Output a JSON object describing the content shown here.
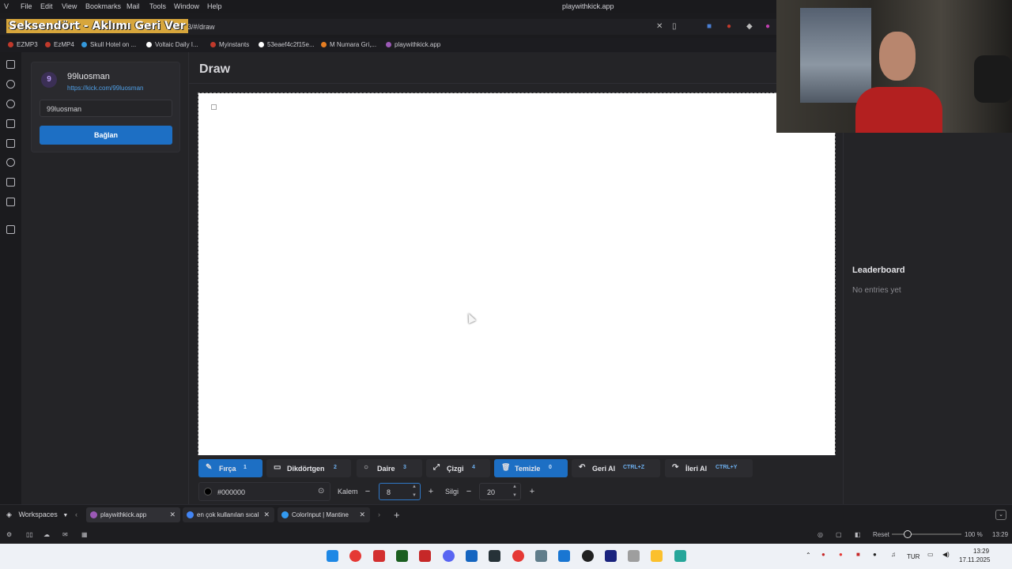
{
  "menubar": {
    "items": [
      "File",
      "Edit",
      "View",
      "Bookmarks",
      "Mail",
      "Tools",
      "Window",
      "Help"
    ],
    "window_title": "playwithkick.app"
  },
  "stream_overlay": {
    "title": "Seksendört - Aklımı Geri Ver"
  },
  "address": {
    "url": "5173/#/draw"
  },
  "bookmarks": [
    {
      "label": "EZMP3",
      "color": "#c0392b"
    },
    {
      "label": "EzMP4",
      "color": "#c0392b"
    },
    {
      "label": "Skull Hotel on ...",
      "color": "#3498db"
    },
    {
      "label": "Voltaic Daily I...",
      "color": "#ffffff"
    },
    {
      "label": "Myinstants",
      "color": "#c0392b"
    },
    {
      "label": "53eaef4c2f15e...",
      "color": "#ffffff"
    },
    {
      "label": "M Numara Gri,...",
      "color": "#e67e22"
    },
    {
      "label": "playwithkick.app",
      "color": "#9b59b6"
    }
  ],
  "user": {
    "avatar_letter": "9",
    "name": "99luosman",
    "link": "https://kick.com/99luosman",
    "input_value": "99luosman",
    "connect_label": "Bağlan"
  },
  "page": {
    "title": "Draw"
  },
  "leaderboard": {
    "title": "Leaderboard",
    "empty": "No entries yet"
  },
  "toolbar": {
    "tools": [
      {
        "icon": "✎",
        "label": "Fırça",
        "key": "1"
      },
      {
        "icon": "▭",
        "label": "Dikdörtgen",
        "key": "2"
      },
      {
        "icon": "○",
        "label": "Daire",
        "key": "3"
      },
      {
        "icon": "⤢",
        "label": "Çizgi",
        "key": "4"
      },
      {
        "icon": "🗑",
        "label": "Temizle",
        "key": "0"
      },
      {
        "icon": "↶",
        "label": "Geri Al",
        "key": "CTRL+Z"
      },
      {
        "icon": "↷",
        "label": "İleri Al",
        "key": "CTRL+Y"
      }
    ],
    "color_value": "#000000",
    "pen_label": "Kalem",
    "pen_size": "8",
    "eraser_label": "Silgi",
    "eraser_size": "20"
  },
  "tabs": {
    "workspaces": "Workspaces",
    "items": [
      {
        "title": "playwithkick.app",
        "fav": "#9b59b6"
      },
      {
        "title": "en çok kullanılan sıcak",
        "fav": "#4285f4"
      },
      {
        "title": "ColorInput | Mantine",
        "fav": "#339af0"
      }
    ]
  },
  "status": {
    "reset": "Reset",
    "zoom": "100 %",
    "time_short": "13:29"
  },
  "taskbar": {
    "lang": "TUR",
    "time": "13:29",
    "date": "17.11.2025"
  }
}
